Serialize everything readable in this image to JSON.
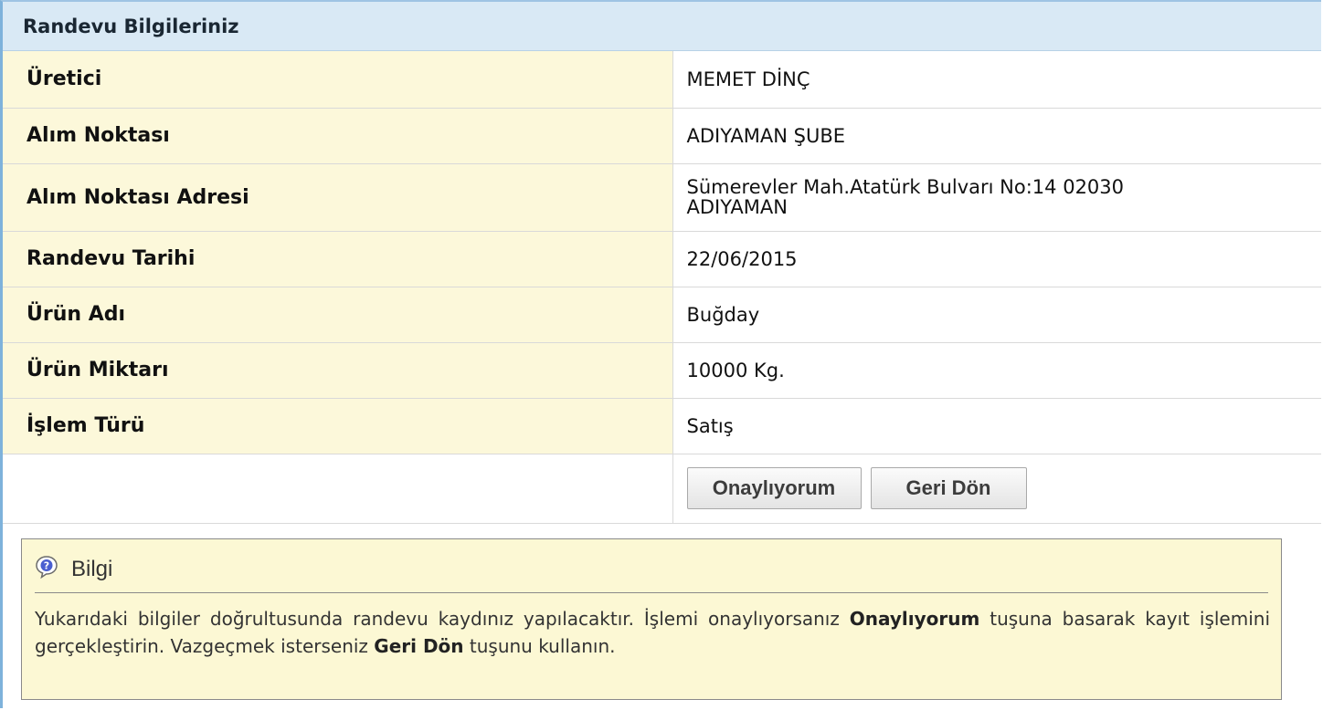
{
  "panel": {
    "title": "Randevu Bilgileriniz"
  },
  "rows": [
    {
      "label": "Üretici",
      "value": "MEMET DİNÇ"
    },
    {
      "label": "Alım Noktası",
      "value": "ADIYAMAN ŞUBE"
    },
    {
      "label": "Alım Noktası Adresi",
      "value_line1": "Sümerevler Mah.Atatürk Bulvarı No:14 02030",
      "value_line2": "ADIYAMAN"
    },
    {
      "label": "Randevu Tarihi",
      "value": "22/06/2015"
    },
    {
      "label": "Ürün Adı",
      "value": "Buğday"
    },
    {
      "label": "Ürün Miktarı",
      "value": "10000 Kg."
    },
    {
      "label": "İşlem Türü",
      "value": "Satış"
    }
  ],
  "buttons": {
    "approve_label": "Onaylıyorum",
    "back_label": "Geri Dön"
  },
  "info_box": {
    "icon": "help-icon",
    "title": "Bilgi",
    "text_part1": "Yukarıdaki bilgiler doğrultusunda randevu kaydınız yapılacaktır. İşlemi onaylıyorsanız ",
    "bold1": "Onaylıyorum",
    "text_part2": " tuşuna basarak kayıt işlemini gerçekleştirin. Vazgeçmek isterseniz ",
    "bold2": "Geri Dön",
    "text_part3": " tuşunu kullanın."
  },
  "colors": {
    "header_bg": "#d9e9f5",
    "label_bg": "#fcf8da",
    "info_bg": "#fcf8d4",
    "border_accent": "#7eb2db"
  }
}
